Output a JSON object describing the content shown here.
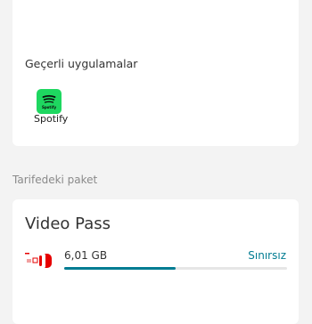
{
  "applicable_apps": {
    "title": "Geçerli uygulamalar",
    "apps": [
      {
        "name": "Spotify",
        "icon": "spotify-icon",
        "icon_caption": "Spotify",
        "color": "#1ed760"
      }
    ]
  },
  "tariff_package": {
    "section_title": "Tarifedeki paket",
    "name": "Video Pass",
    "usage_amount": "6,01 GB",
    "usage_limit": "Sınırsız",
    "usage_progress_fraction": 0.5,
    "thumbnail_icon": "video-pass-icon",
    "accent_color": "#007c92",
    "brand_color": "#e60000"
  }
}
